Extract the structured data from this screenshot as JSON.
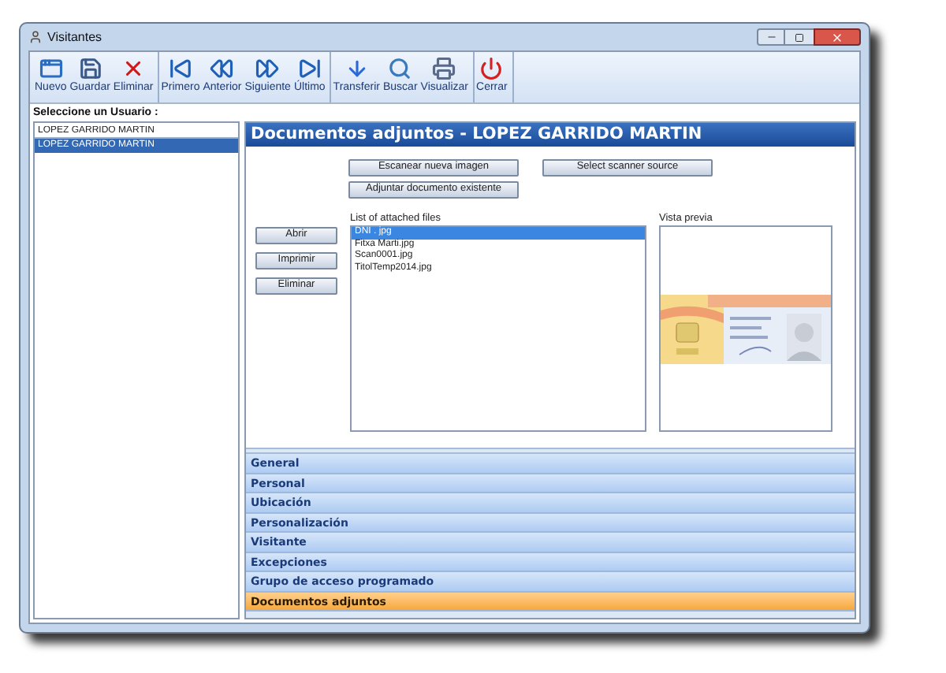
{
  "window": {
    "title": "Visitantes"
  },
  "toolbar": {
    "groups": [
      {
        "buttons": [
          {
            "label": "Nuevo"
          },
          {
            "label": "Guardar"
          },
          {
            "label": "Eliminar"
          }
        ]
      },
      {
        "buttons": [
          {
            "label": "Primero"
          },
          {
            "label": "Anterior"
          },
          {
            "label": "Siguiente"
          },
          {
            "label": "Último"
          }
        ]
      },
      {
        "buttons": [
          {
            "label": "Transferir"
          },
          {
            "label": "Buscar"
          },
          {
            "label": "Visualizar"
          }
        ]
      },
      {
        "buttons": [
          {
            "label": "Cerrar"
          }
        ]
      }
    ]
  },
  "users": {
    "label": "Seleccione un Usuario :",
    "search": {
      "value": "LOPEZ GARRIDO MARTIN"
    },
    "items": [
      {
        "name": "LOPEZ GARRIDO MARTIN",
        "selected": true
      }
    ]
  },
  "panel": {
    "title": "Documentos adjuntos - LOPEZ GARRIDO MARTIN",
    "top_buttons": [
      "Escanear nueva imagen",
      "Select scanner source",
      "Adjuntar documento existente"
    ],
    "side_buttons": [
      "Abrir",
      "Imprimir",
      "Eliminar"
    ],
    "files_label": "List of attached files",
    "files": [
      {
        "name": "DNI . jpg",
        "selected": true
      },
      {
        "name": "Fitxa Marti.jpg",
        "selected": false
      },
      {
        "name": "Scan0001.jpg",
        "selected": false
      },
      {
        "name": "TitolTemp2014.jpg",
        "selected": false
      }
    ],
    "preview": {
      "label": "Vista previa",
      "kind": "picture"
    }
  },
  "sections": [
    {
      "label": "General",
      "selected": false
    },
    {
      "label": "Personal",
      "selected": false
    },
    {
      "label": "Ubicación",
      "selected": false
    },
    {
      "label": "Personalización",
      "selected": false
    },
    {
      "label": "Visitante",
      "selected": false
    },
    {
      "label": "Excepciones",
      "selected": false
    },
    {
      "label": "Grupo de acceso programado",
      "selected": false
    },
    {
      "label": "Documentos adjuntos",
      "selected": true
    }
  ]
}
